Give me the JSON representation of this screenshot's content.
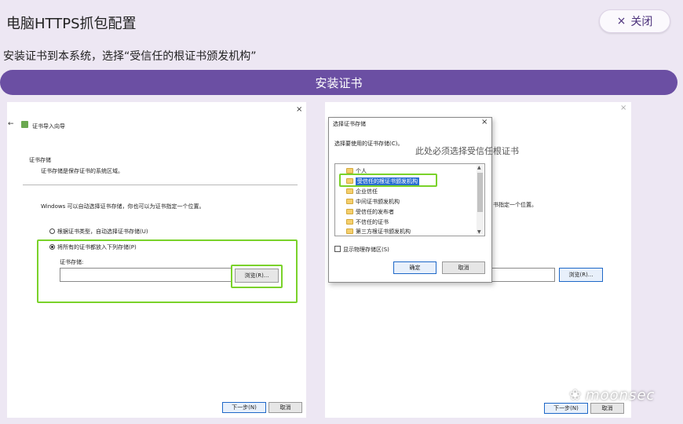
{
  "header": {
    "title": "电脑HTTPS抓包配置",
    "close_label": "关闭",
    "close_icon": "×"
  },
  "subtitle": "安装证书到本系统，选择“受信任的根证书颁发机构”",
  "install_button": "安装证书",
  "wizard": {
    "close_icon": "×",
    "back_icon": "←",
    "title": "证书导入向导",
    "section_title": "证书存储",
    "section_desc": "证书存储是保存证书的系统区域。",
    "info": "Windows 可以自动选择证书存储，你也可以为证书指定一个位置。",
    "radio_auto": "根据证书类型，自动选择证书存储(U)",
    "radio_manual": "将所有的证书都放入下列存储(P)",
    "store_label": "证书存储:",
    "browse": "浏览(R)...",
    "next": "下一步(N)",
    "cancel": "取消"
  },
  "wizard2": {
    "close_icon": "×",
    "info_fragment": "书指定一个位置。",
    "browse": "浏览(R)...",
    "next": "下一步(N)",
    "cancel": "取消"
  },
  "dialog": {
    "title": "选择证书存储",
    "close_icon": "×",
    "prompt": "选择要使用的证书存储(C)。",
    "items": [
      "个人",
      "受信任的根证书颁发机构",
      "企业信任",
      "中间证书颁发机构",
      "受信任的发布者",
      "不信任的证书",
      "第三方根证书颁发机构"
    ],
    "show_physical": "显示物理存储区(S)",
    "ok": "确定",
    "cancel": "取消"
  },
  "annotation": "此处必须选择受信任根证书",
  "watermark": {
    "icon": "wechat-icon",
    "text": "moonsec"
  }
}
